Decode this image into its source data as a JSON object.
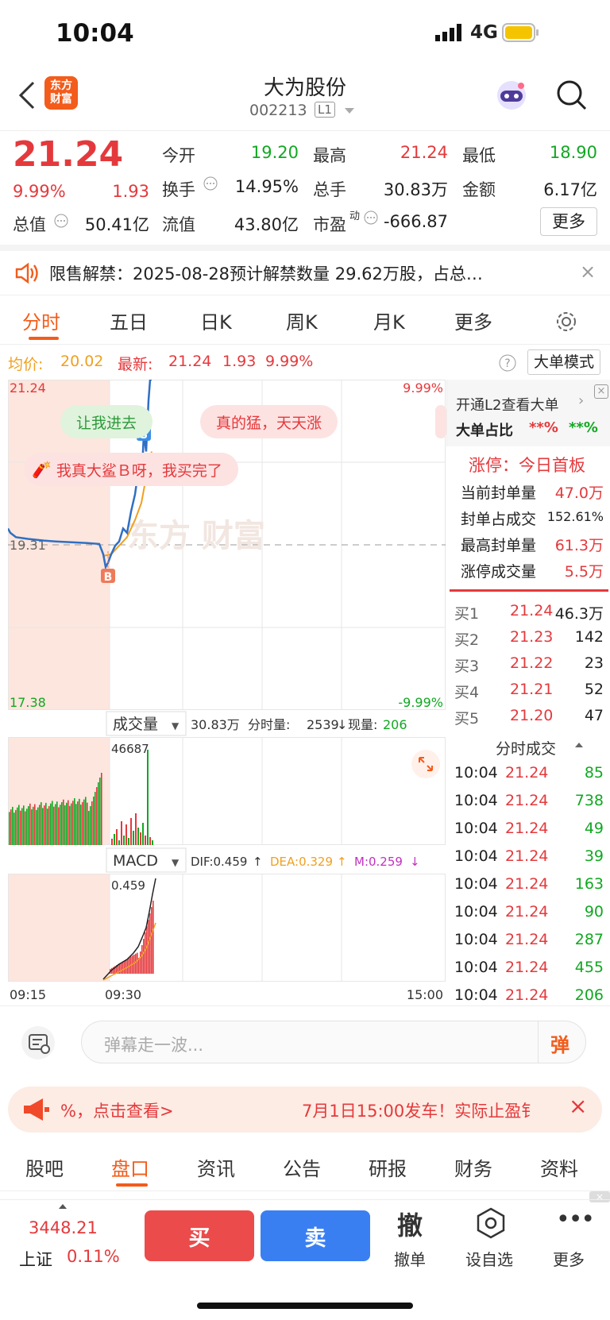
{
  "status": {
    "time": "10:04",
    "network": "4G"
  },
  "header": {
    "name": "大为股份",
    "code": "002213",
    "level": "L1",
    "logo": "东方\n财富"
  },
  "quote": {
    "price": "21.24",
    "pct": "9.99%",
    "chg": "1.93",
    "today_open_label": "今开",
    "today_open": "19.20",
    "high_label": "最高",
    "high": "21.24",
    "low_label": "最低",
    "low": "18.90",
    "turnover_label": "换手",
    "turnover": "14.95%",
    "vol_label": "总手",
    "vol": "30.83万",
    "amount_label": "金额",
    "amount": "6.17亿",
    "mktcap_label": "总值",
    "mktcap": "50.41亿",
    "float_label": "流值",
    "float": "43.80亿",
    "pe_label": "市盈",
    "pe_sup": "动",
    "pe": "-666.87",
    "more": "更多"
  },
  "notice": {
    "text": "限售解禁：2025-08-28预计解禁数量 29.62万股，占总…"
  },
  "chart_tabs": [
    "分时",
    "五日",
    "日K",
    "周K",
    "月K",
    "更多"
  ],
  "subbar": {
    "avg_label": "均价:",
    "avg": "20.02",
    "latest_label": "最新:",
    "latest": "21.24",
    "chg": "1.93",
    "pct": "9.99%",
    "mode": "大单模式"
  },
  "chart_data": {
    "type": "line",
    "y_top": "21.24",
    "y_mid": "19.31",
    "y_bottom": "17.38",
    "pct_top": "9.99%",
    "pct_bottom": "-9.99%",
    "x_start": "09:15",
    "x_mid": "09:30",
    "x_end": "15:00",
    "price_points": [
      [
        0,
        19.5
      ],
      [
        3,
        19.45
      ],
      [
        10,
        19.4
      ],
      [
        25,
        19.38
      ],
      [
        45,
        19.36
      ],
      [
        60,
        19.35
      ],
      [
        80,
        19.34
      ],
      [
        100,
        19.33
      ],
      [
        115,
        19.32
      ],
      [
        120,
        19.2
      ],
      [
        123,
        19.05
      ],
      [
        126,
        19.1
      ],
      [
        130,
        19.2
      ],
      [
        135,
        19.3
      ],
      [
        140,
        19.35
      ],
      [
        145,
        19.5
      ],
      [
        150,
        19.45
      ],
      [
        155,
        19.7
      ],
      [
        160,
        19.9
      ],
      [
        163,
        20.1
      ],
      [
        166,
        20.3
      ],
      [
        168,
        20.0
      ],
      [
        171,
        20.6
      ],
      [
        174,
        20.4
      ],
      [
        177,
        21.0
      ],
      [
        179,
        21.24
      ],
      [
        181,
        21.24
      ]
    ],
    "avg_points": [
      [
        120,
        19.18
      ],
      [
        130,
        19.2
      ],
      [
        140,
        19.3
      ],
      [
        150,
        19.4
      ],
      [
        160,
        19.6
      ],
      [
        168,
        19.8
      ],
      [
        172,
        20.0
      ],
      [
        178,
        20.3
      ],
      [
        181,
        20.4
      ]
    ],
    "volume": {
      "label": "成交量",
      "total": "30.83万",
      "fen_label": "分时量:",
      "fen": "2539",
      "now_label": "现量:",
      "now": "206",
      "max": "46687"
    },
    "macd": {
      "label": "MACD",
      "dif": "DIF:0.459",
      "dea": "DEA:0.329",
      "m": "M:0.259",
      "max": "0.459"
    }
  },
  "danmaku": [
    "让我进去",
    "真的猛，天天涨",
    "我真大鲨Ｂ呀，我买完了"
  ],
  "l2": {
    "title": "开通L2查看大单",
    "ratio_label": "大单占比",
    "r1": "**%",
    "r2": "**%"
  },
  "limit": {
    "title": "涨停：今日首板",
    "rows": [
      {
        "k": "当前封单量",
        "v": "47.0万"
      },
      {
        "k": "封单占成交",
        "v": "152.61%"
      },
      {
        "k": "最高封单量",
        "v": "61.3万"
      },
      {
        "k": "涨停成交量",
        "v": "5.5万"
      }
    ]
  },
  "orderbook": [
    {
      "k": "买1",
      "p": "21.24",
      "v": "46.3万"
    },
    {
      "k": "买2",
      "p": "21.23",
      "v": "142"
    },
    {
      "k": "买3",
      "p": "21.22",
      "v": "23"
    },
    {
      "k": "买4",
      "p": "21.21",
      "v": "52"
    },
    {
      "k": "买5",
      "p": "21.20",
      "v": "47"
    }
  ],
  "ticks_title": "分时成交",
  "ticks": [
    {
      "t": "10:04",
      "p": "21.24",
      "v": "85"
    },
    {
      "t": "10:04",
      "p": "21.24",
      "v": "738"
    },
    {
      "t": "10:04",
      "p": "21.24",
      "v": "49"
    },
    {
      "t": "10:04",
      "p": "21.24",
      "v": "39"
    },
    {
      "t": "10:04",
      "p": "21.24",
      "v": "163"
    },
    {
      "t": "10:04",
      "p": "21.24",
      "v": "90"
    },
    {
      "t": "10:04",
      "p": "21.24",
      "v": "287"
    },
    {
      "t": "10:04",
      "p": "21.24",
      "v": "455"
    },
    {
      "t": "10:04",
      "p": "21.24",
      "v": "206"
    }
  ],
  "comment": {
    "placeholder": "弹幕走一波...",
    "send": "弹"
  },
  "ad": {
    "left": "%，点击查看>",
    "right": "7月1日15:00发车！实际止盈钅"
  },
  "bottom_tabs": [
    "股吧",
    "盘口",
    "资讯",
    "公告",
    "研报",
    "财务",
    "资料"
  ],
  "dock": {
    "index_value": "3448.21",
    "index_name": "上证",
    "index_pct": "0.11%",
    "buy": "买",
    "sell": "卖",
    "cancel_icon": "撤",
    "cancel": "撤单",
    "watch": "设自选",
    "more": "更多"
  },
  "colors": {
    "up": "#e4393c",
    "down": "#11a822",
    "accent": "#f35c1b"
  }
}
